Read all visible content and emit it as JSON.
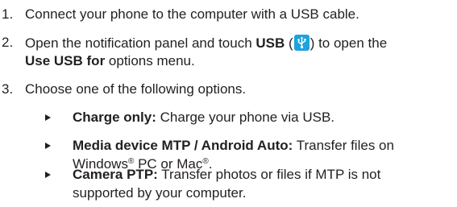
{
  "steps": [
    {
      "number": "1.",
      "text": "Connect your phone to the computer with a USB cable."
    },
    {
      "number": "2.",
      "pre": "Open the notification panel and touch ",
      "bold1": "USB",
      "paren_open": " (",
      "paren_close": ") to open the",
      "bold2": "Use USB for",
      "post": " options menu.",
      "icon": "usb-icon"
    },
    {
      "number": "3.",
      "text": "Choose one of the following options."
    }
  ],
  "options": [
    {
      "label": "Charge only:",
      "desc": " Charge your phone via USB."
    },
    {
      "label": "Media device MTP / Android Auto:",
      "desc": " Transfer files on",
      "desc2_a": "Windows",
      "reg1": "®",
      "desc2_b": " PC or Mac",
      "reg2": "®",
      "desc2_c": "."
    },
    {
      "label": "Camera PTP:",
      "desc": " Transfer photos or files if MTP is not",
      "desc2": "supported by your computer."
    }
  ],
  "colors": {
    "text": "#231f20",
    "usb_icon_bg": "#1ea3dc"
  }
}
